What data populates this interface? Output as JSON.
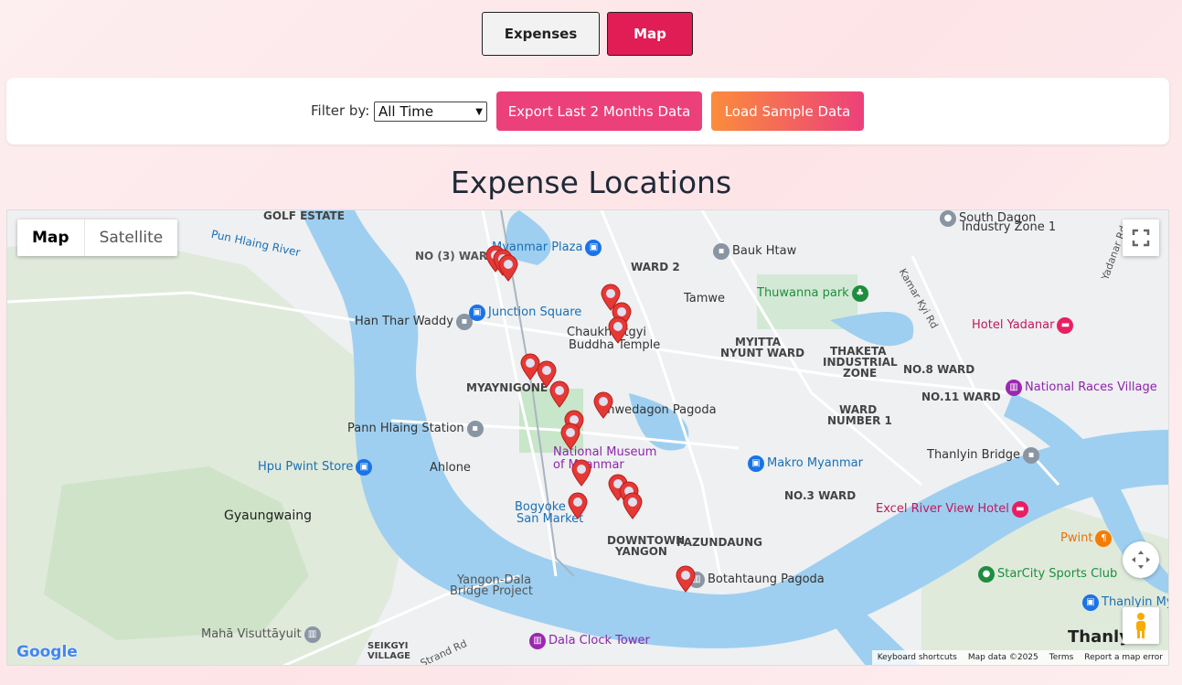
{
  "tabs": {
    "expenses": "Expenses",
    "map": "Map"
  },
  "filter": {
    "label": "Filter by:",
    "selected": "All Time",
    "export_label": "Export Last 2 Months Data",
    "sample_label": "Load Sample Data"
  },
  "section_title": "Expense Locations",
  "map": {
    "type_map": "Map",
    "type_satellite": "Satellite",
    "attribution": {
      "logo": "Google",
      "shortcuts": "Keyboard shortcuts",
      "data": "Map data ©2025",
      "terms": "Terms",
      "report": "Report a map error"
    },
    "labels": {
      "golf_estate": "GOLF ESTATE",
      "pun_hlaing": "Pun Hlaing River",
      "no3ward": "NO (3) WARD",
      "myanmar_plaza": "Myanmar Plaza",
      "bauk_htaw": "Bauk Htaw",
      "ward2": "WARD 2",
      "south_dagon": "South Dagon",
      "industry_zone": "Industry Zone 1",
      "yadanar_rd": "Yadanar Rd",
      "kamar_kyi": "Kamar Kyi Rd",
      "tamwe": "Tamwe",
      "thuwanna": "Thuwanna park",
      "han_thar": "Han Thar Waddy",
      "junction": "Junction Square",
      "chaukhtatgyi": "Chaukhtatgyi",
      "buddha_temple": "Buddha Temple",
      "hotel_yadanar": "Hotel Yadanar",
      "myitta": "MYITTA",
      "nyunt": "NYUNT WARD",
      "thaketa": "THAKETA",
      "industrial": "INDUSTRIAL",
      "zone": "ZONE",
      "no8": "NO.8 WARD",
      "national_races": "National Races Village",
      "myaynigone": "MYAYNIGONE",
      "no11": "NO.11 WARD",
      "shwedagon": "Shwedagon Pagoda",
      "ward": "WARD",
      "number1": "NUMBER 1",
      "pann_hlaing": "Pann Hlaing Station",
      "national_museum": "National Museum",
      "of_myanmar": "of Myanmar",
      "thanlyin_bridge": "Thanlyin Bridge",
      "hpu_pwint": "Hpu Pwint Store",
      "ahlone": "Ahlone",
      "makro": "Makro Myanmar",
      "bogyoke": "Bogyoke",
      "san_market": "San Market",
      "no3": "NO.3 WARD",
      "excel_river": "Excel River View Hotel",
      "gyaungwaing": "Gyaungwaing",
      "downtown": "DOWNTOWN",
      "yangon": "YANGON",
      "pazundaung": "PAZUNDAUNG",
      "pwint": "Pwint",
      "starcity": "StarCity Sports Club",
      "dala_bridge": "Yangon-Dala",
      "bridge_project": "Bridge Project",
      "botahtaung": "Botahtaung Pagoda",
      "thanlyin_my": "Thanlyin My",
      "mahā": "Mahā Visuttāyuit",
      "seikgyi": "SEIKGYI",
      "village": "VILLAGE",
      "dala_clock": "Dala Clock Tower",
      "thanly": "Thanly...",
      "strand": "Strand Rd"
    }
  },
  "colors": {
    "brand": "#e11d55",
    "export": "#ec407a",
    "sample_start": "#fb8c3c",
    "water": "#9ecff0",
    "park": "#c8e6c9",
    "pin": "#e53935"
  }
}
